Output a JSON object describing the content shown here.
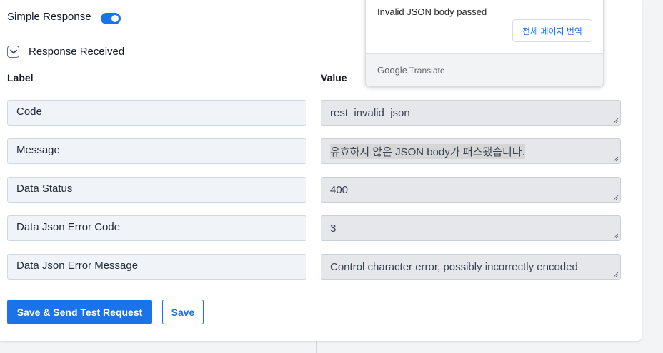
{
  "settings": {
    "simple_response_label": "Simple Response",
    "simple_response_on": true,
    "response_received_label": "Response Received"
  },
  "table": {
    "label_header": "Label",
    "value_header": "Value",
    "rows": [
      {
        "label": "Code",
        "value": "rest_invalid_json"
      },
      {
        "label": "Message",
        "value": "유효하지 않은 JSON body가 패스됐습니다."
      },
      {
        "label": "Data Status",
        "value": "400"
      },
      {
        "label": "Data Json Error Code",
        "value": "3"
      },
      {
        "label": "Data Json Error Message",
        "value": "Control character error, possibly incorrectly encoded"
      }
    ]
  },
  "actions": {
    "save_send_label": "Save & Send Test Request",
    "save_label": "Save"
  },
  "translate_popup": {
    "original_text": "Invalid JSON body passed",
    "translate_page_button": "전체 페이지 번역",
    "brand_google": "Google",
    "brand_translate": "Translate"
  },
  "colors": {
    "accent": "#1a73e8",
    "value_bg": "#e5e7eb",
    "label_bg": "#f0f4f8"
  },
  "icons": {
    "toggle": "toggle-switch-icon",
    "collapse": "chevron-down-icon",
    "resize": "resize-handle-icon"
  }
}
